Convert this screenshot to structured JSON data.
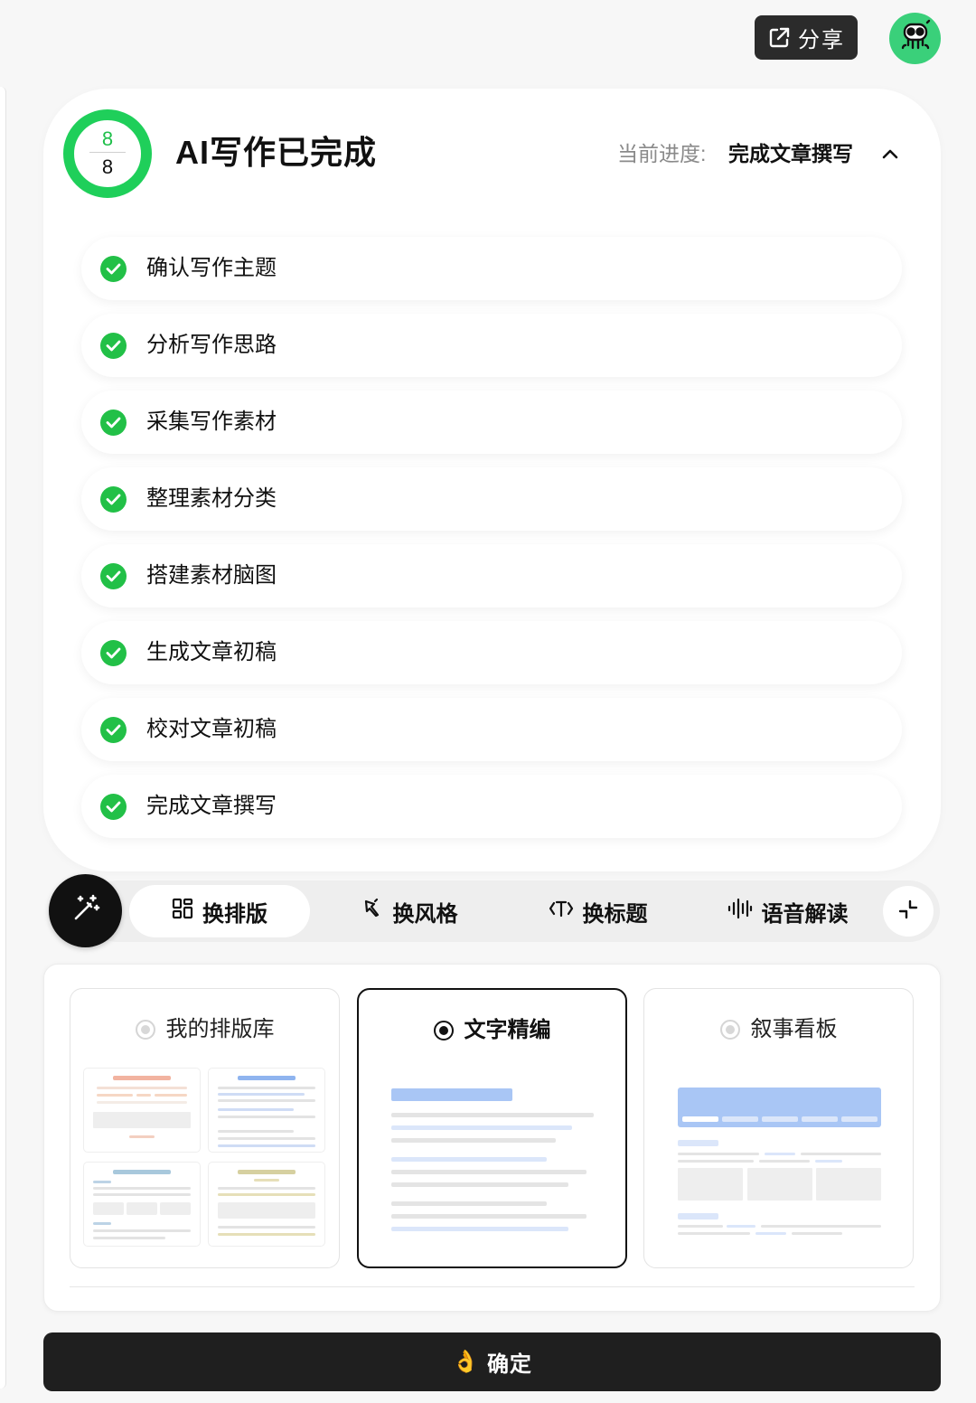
{
  "header": {
    "share_label": "分享",
    "share_icon": "external-share-icon",
    "avatar_icon": "robot-avatar-icon"
  },
  "status": {
    "done_count": "8",
    "total_count": "8",
    "title": "AI写作已完成",
    "progress_label": "当前进度:",
    "progress_value": "完成文章撰写",
    "accent_color": "#1fcf5a"
  },
  "steps": [
    {
      "label": "确认写作主题"
    },
    {
      "label": "分析写作思路"
    },
    {
      "label": "采集写作素材"
    },
    {
      "label": "整理素材分类"
    },
    {
      "label": "搭建素材脑图"
    },
    {
      "label": "生成文章初稿"
    },
    {
      "label": "校对文章初稿"
    },
    {
      "label": "完成文章撰写"
    }
  ],
  "toolbar": {
    "magic_icon": "magic-wand-icon",
    "tabs": [
      {
        "label": "换排版",
        "icon": "grid-layout-icon"
      },
      {
        "label": "换风格",
        "icon": "style-brush-icon"
      },
      {
        "label": "换标题",
        "icon": "title-text-icon"
      },
      {
        "label": "语音解读",
        "icon": "audio-wave-icon"
      }
    ],
    "collapse_icon": "collapse-icon"
  },
  "layout_options": [
    {
      "label": "我的排版库",
      "selected": false
    },
    {
      "label": "文字精编",
      "selected": true
    },
    {
      "label": "叙事看板",
      "selected": false
    }
  ],
  "confirm": {
    "emoji": "👌",
    "label": "确定"
  }
}
